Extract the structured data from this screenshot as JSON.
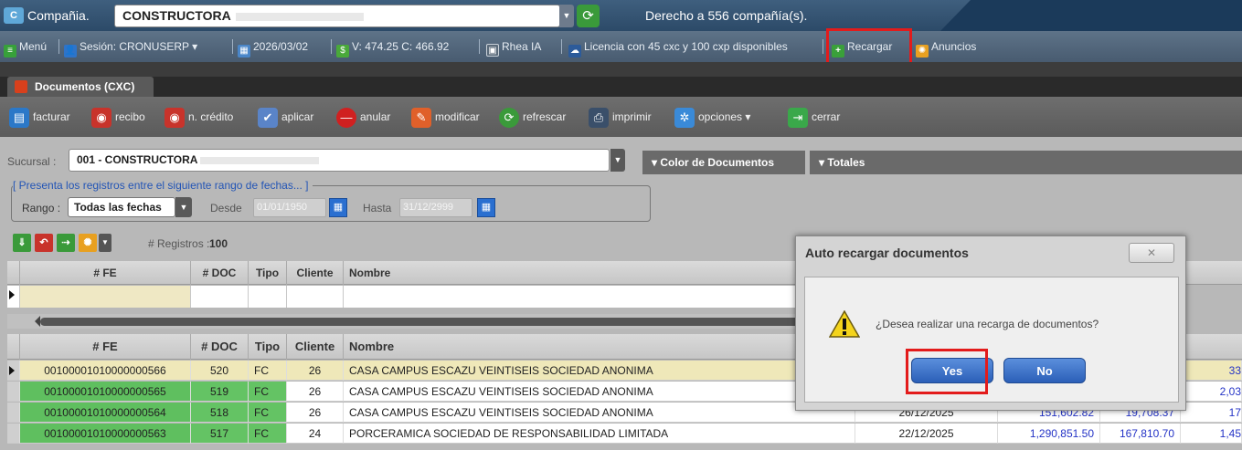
{
  "company": {
    "label": "Compañia.",
    "name": "CONSTRUCTORA",
    "rights": "Derecho a 556 compañía(s)."
  },
  "menu": {
    "menu": "Menú",
    "session": "Sesión: CRONUSERP ▾",
    "date": "2026/03/02",
    "rates": "V: 474.25 C: 466.92",
    "ai": "Rhea IA",
    "license": "Licencia con 45 cxc y 100 cxp disponibles",
    "reload": "Recargar",
    "ads": "Anuncios"
  },
  "tab": {
    "title": "Documentos (CXC)"
  },
  "toolbar": {
    "facturar": "facturar",
    "recibo": "recibo",
    "credito": "n. crédito",
    "aplicar": "aplicar",
    "anular": "anular",
    "modificar": "modificar",
    "refrescar": "refrescar",
    "imprimir": "imprimir",
    "opciones": "opciones ▾",
    "cerrar": "cerrar"
  },
  "filters": {
    "sucursal_label": "Sucursal :",
    "sucursal_value": "001 - CONSTRUCTORA",
    "color_btn": "▾ Color de Documentos",
    "totales": "▾ Totales",
    "legend": "[ Presenta los registros entre el siguiente rango de fechas... ]",
    "rango_label": "Rango :",
    "rango_value": "Todas las fechas",
    "desde_label": "Desde",
    "desde_value": "01/01/1950",
    "hasta_label": "Hasta",
    "hasta_value": "31/12/2999",
    "count_label": "# Registros :",
    "count_value": "100"
  },
  "grid": {
    "headers": {
      "fe": "# FE",
      "doc": "# DOC",
      "tipo": "Tipo",
      "cliente": "Cliente",
      "nombre": "Nombre"
    },
    "rows": [
      {
        "fe": "00100001010000000566",
        "doc": "520",
        "tipo": "FC",
        "cliente": "26",
        "nombre": "CASA CAMPUS ESCAZU VEINTISEIS SOCIEDAD ANONIMA",
        "fecha": "",
        "monto": "",
        "imp": "",
        "extra": "33"
      },
      {
        "fe": "00100001010000000565",
        "doc": "519",
        "tipo": "FC",
        "cliente": "26",
        "nombre": "CASA CAMPUS ESCAZU VEINTISEIS SOCIEDAD ANONIMA",
        "fecha": "",
        "monto": "",
        "imp": "",
        "extra": "2,03"
      },
      {
        "fe": "00100001010000000564",
        "doc": "518",
        "tipo": "FC",
        "cliente": "26",
        "nombre": "CASA CAMPUS ESCAZU VEINTISEIS SOCIEDAD ANONIMA",
        "fecha": "26/12/2025",
        "monto": "151,602.82",
        "imp": "19,708.37",
        "extra": "17"
      },
      {
        "fe": "00100001010000000563",
        "doc": "517",
        "tipo": "FC",
        "cliente": "24",
        "nombre": "PORCERAMICA SOCIEDAD DE RESPONSABILIDAD LIMITADA",
        "fecha": "22/12/2025",
        "monto": "1,290,851.50",
        "imp": "167,810.70",
        "extra": "1,45"
      }
    ]
  },
  "dialog": {
    "title": "Auto recargar documentos",
    "close": "✕",
    "message": "¿Desea realizar una recarga de documentos?",
    "yes": "Yes",
    "no": "No"
  }
}
